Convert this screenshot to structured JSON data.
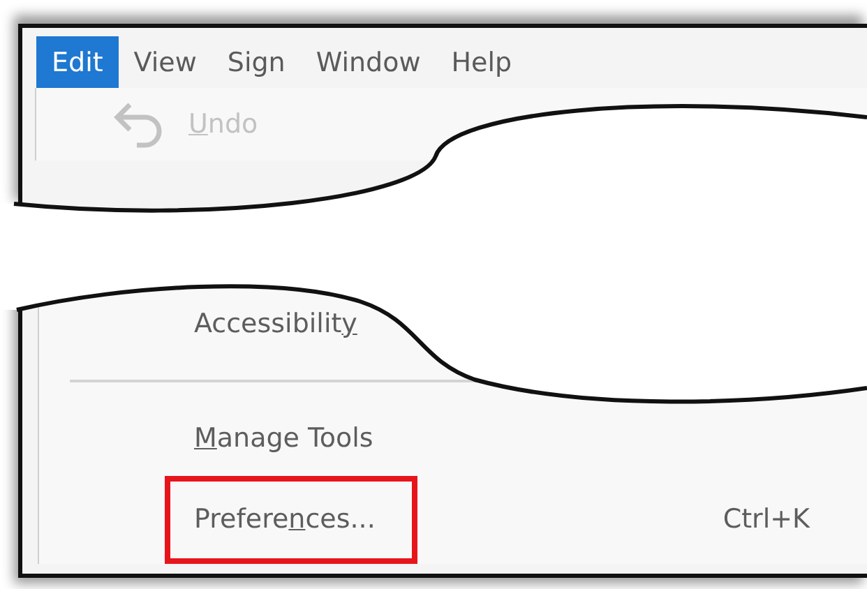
{
  "menu_bar": [
    {
      "label": "Edit",
      "selected": true
    },
    {
      "label": "View",
      "selected": false
    },
    {
      "label": "Sign",
      "selected": false
    },
    {
      "label": "Window",
      "selected": false
    },
    {
      "label": "Help",
      "selected": false
    }
  ],
  "menu_sections": [
    {
      "items": [
        {
          "kind": "command",
          "label": {
            "key": "U",
            "after": "ndo"
          },
          "disabled": true
        }
      ]
    },
    {
      "items": [
        {
          "kind": "command",
          "label": {
            "before": "Accessibilit",
            "key": "y"
          },
          "disabled": false
        },
        {
          "kind": "separator"
        },
        {
          "kind": "command",
          "label": {
            "key": "M",
            "after": "anage Tools"
          },
          "disabled": false
        },
        {
          "kind": "command",
          "label": {
            "before": "Prefere",
            "key": "n",
            "after": "ces..."
          },
          "shortcut": "Ctrl+K",
          "disabled": false,
          "highlighted": true
        }
      ]
    }
  ]
}
